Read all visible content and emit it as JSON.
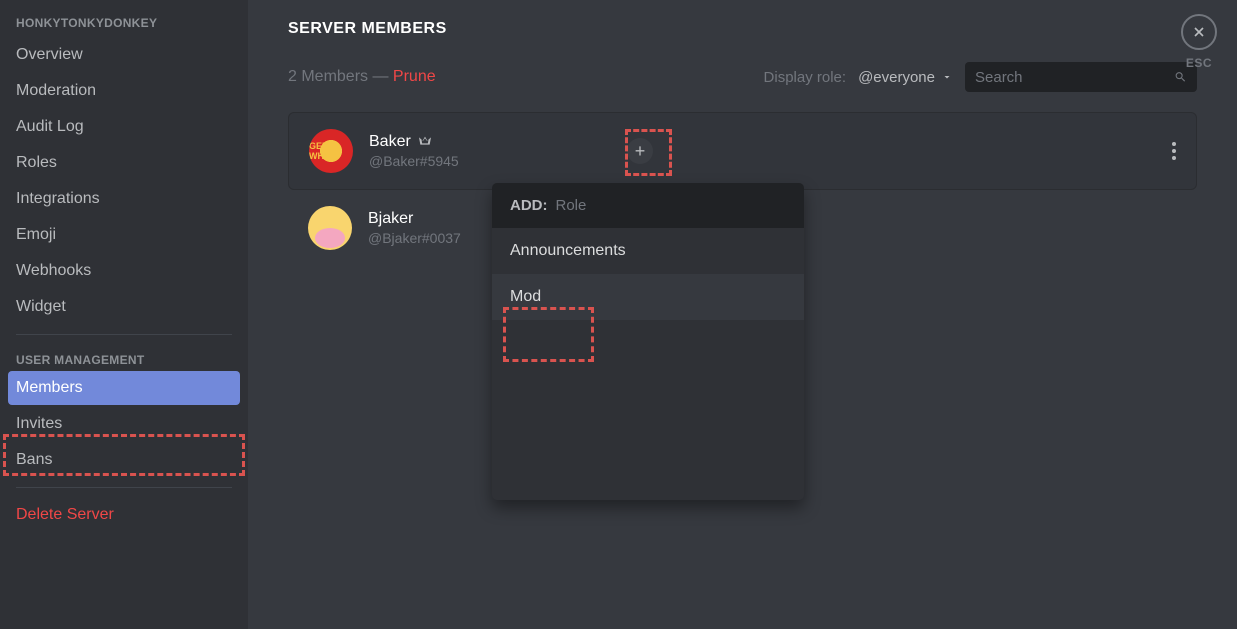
{
  "sidebar": {
    "header": "HONKYTONKYDONKEY",
    "section1": [
      {
        "label": "Overview"
      },
      {
        "label": "Moderation"
      },
      {
        "label": "Audit Log"
      },
      {
        "label": "Roles"
      },
      {
        "label": "Integrations"
      },
      {
        "label": "Emoji"
      },
      {
        "label": "Webhooks"
      },
      {
        "label": "Widget"
      }
    ],
    "section2_label": "USER MANAGEMENT",
    "section2": [
      {
        "label": "Members",
        "active": true
      },
      {
        "label": "Invites"
      },
      {
        "label": "Bans"
      }
    ],
    "delete": "Delete Server"
  },
  "page": {
    "title": "SERVER MEMBERS",
    "count_prefix": "2 Members — ",
    "prune": "Prune",
    "display_role_label": "Display role:",
    "display_role_value": "@everyone",
    "search_placeholder": "Search",
    "esc": "ESC"
  },
  "members": [
    {
      "name": "Baker",
      "tag": "@Baker#5945",
      "owner": true
    },
    {
      "name": "Bjaker",
      "tag": "@Bjaker#0037",
      "owner": false
    }
  ],
  "popover": {
    "add_label": "ADD:",
    "placeholder": "Role",
    "items": [
      {
        "label": "Announcements",
        "hovered": false
      },
      {
        "label": "Mod",
        "hovered": true
      }
    ]
  },
  "avatar1_text": "GEE WHIZ"
}
